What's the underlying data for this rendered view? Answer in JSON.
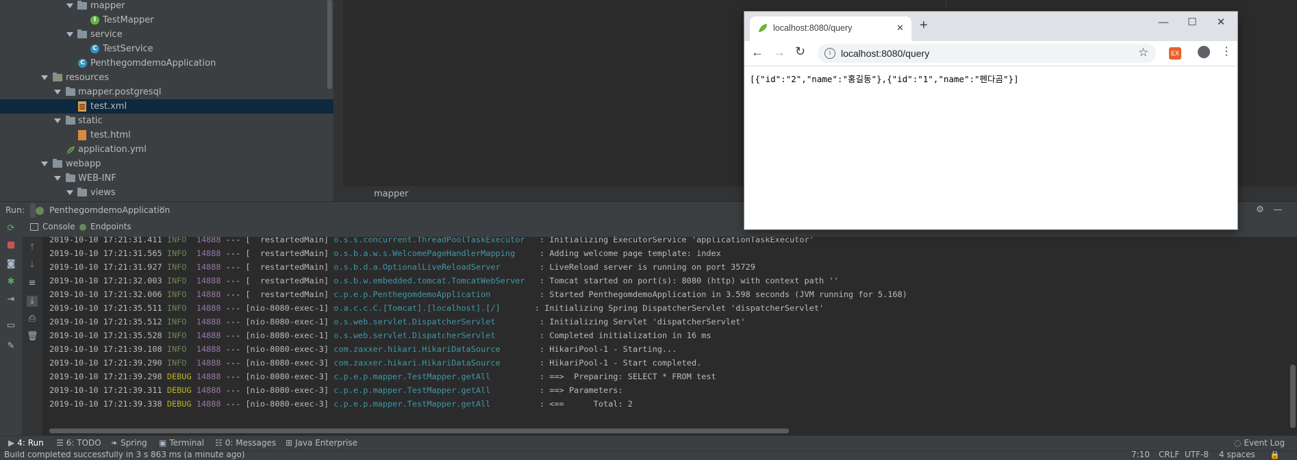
{
  "project_tree": {
    "items": [
      {
        "label": "mapper",
        "kind": "folder"
      },
      {
        "label": "TestMapper",
        "kind": "mapper-file"
      },
      {
        "label": "service",
        "kind": "folder"
      },
      {
        "label": "TestService",
        "kind": "class-file"
      },
      {
        "label": "PenthegomdemoApplication",
        "kind": "springboot-file"
      },
      {
        "label": "resources",
        "kind": "resources-folder"
      },
      {
        "label": "mapper.postgresql",
        "kind": "folder"
      },
      {
        "label": "test.xml",
        "kind": "xml-file",
        "selected": true
      },
      {
        "label": "static",
        "kind": "folder"
      },
      {
        "label": "test.html",
        "kind": "html-file"
      },
      {
        "label": "application.yml",
        "kind": "yml-file"
      },
      {
        "label": "webapp",
        "kind": "folder"
      },
      {
        "label": "WEB-INF",
        "kind": "folder"
      },
      {
        "label": "views",
        "kind": "folder"
      }
    ]
  },
  "editor": {
    "breadcrumb": "mapper"
  },
  "run_panel": {
    "run_label": "Run:",
    "config_tab": "PenthegomdemoApplication",
    "subtabs": [
      "Console",
      "Endpoints"
    ]
  },
  "console": {
    "lines": [
      {
        "ts": "2019-10-10 17:21:31.411",
        "level": "INFO ",
        "pid": "14888",
        "sep": " --- [",
        "thread": "  restartedMain]",
        "logger": " o.s.s.concurrent.ThreadPoolTaskExecutor  ",
        "msg": " : Initializing ExecutorService 'applicationTaskExecutor'"
      },
      {
        "ts": "2019-10-10 17:21:31.565",
        "level": "INFO ",
        "pid": "14888",
        "sep": " --- [",
        "thread": "  restartedMain]",
        "logger": " o.s.b.a.w.s.WelcomePageHandlerMapping    ",
        "msg": " : Adding welcome page template: index"
      },
      {
        "ts": "2019-10-10 17:21:31.927",
        "level": "INFO ",
        "pid": "14888",
        "sep": " --- [",
        "thread": "  restartedMain]",
        "logger": " o.s.b.d.a.OptionalLiveReloadServer       ",
        "msg": " : LiveReload server is running on port 35729"
      },
      {
        "ts": "2019-10-10 17:21:32.003",
        "level": "INFO ",
        "pid": "14888",
        "sep": " --- [",
        "thread": "  restartedMain]",
        "logger": " o.s.b.w.embedded.tomcat.TomcatWebServer  ",
        "msg": " : Tomcat started on port(s): 8080 (http) with context path ''"
      },
      {
        "ts": "2019-10-10 17:21:32.006",
        "level": "INFO ",
        "pid": "14888",
        "sep": " --- [",
        "thread": "  restartedMain]",
        "logger": " c.p.e.p.PenthegomdemoApplication         ",
        "msg": " : Started PenthegomdemoApplication in 3.598 seconds (JVM running for 5.168)"
      },
      {
        "ts": "2019-10-10 17:21:35.511",
        "level": "INFO ",
        "pid": "14888",
        "sep": " --- [",
        "thread": "nio-8080-exec-1]",
        "logger": " o.a.c.c.C.[Tomcat].[localhost].[/]      ",
        "msg": " : Initializing Spring DispatcherServlet 'dispatcherServlet'"
      },
      {
        "ts": "2019-10-10 17:21:35.512",
        "level": "INFO ",
        "pid": "14888",
        "sep": " --- [",
        "thread": "nio-8080-exec-1]",
        "logger": " o.s.web.servlet.DispatcherServlet        ",
        "msg": " : Initializing Servlet 'dispatcherServlet'"
      },
      {
        "ts": "2019-10-10 17:21:35.528",
        "level": "INFO ",
        "pid": "14888",
        "sep": " --- [",
        "thread": "nio-8080-exec-1]",
        "logger": " o.s.web.servlet.DispatcherServlet        ",
        "msg": " : Completed initialization in 16 ms"
      },
      {
        "ts": "2019-10-10 17:21:39.108",
        "level": "INFO ",
        "pid": "14888",
        "sep": " --- [",
        "thread": "nio-8080-exec-3]",
        "logger": " com.zaxxer.hikari.HikariDataSource       ",
        "msg": " : HikariPool-1 - Starting..."
      },
      {
        "ts": "2019-10-10 17:21:39.290",
        "level": "INFO ",
        "pid": "14888",
        "sep": " --- [",
        "thread": "nio-8080-exec-3]",
        "logger": " com.zaxxer.hikari.HikariDataSource       ",
        "msg": " : HikariPool-1 - Start completed."
      },
      {
        "ts": "2019-10-10 17:21:39.298",
        "level": "DEBUG",
        "pid": "14888",
        "sep": " --- [",
        "thread": "nio-8080-exec-3]",
        "logger": " c.p.e.p.mapper.TestMapper.getAll         ",
        "msg": " : ==>  Preparing: SELECT * FROM test"
      },
      {
        "ts": "2019-10-10 17:21:39.311",
        "level": "DEBUG",
        "pid": "14888",
        "sep": " --- [",
        "thread": "nio-8080-exec-3]",
        "logger": " c.p.e.p.mapper.TestMapper.getAll         ",
        "msg": " : ==> Parameters: "
      },
      {
        "ts": "2019-10-10 17:21:39.338",
        "level": "DEBUG",
        "pid": "14888",
        "sep": " --- [",
        "thread": "nio-8080-exec-3]",
        "logger": " c.p.e.p.mapper.TestMapper.getAll         ",
        "msg": " : <==      Total: 2"
      }
    ]
  },
  "bottom_tabs": [
    {
      "label": "4: Run",
      "icon": "run-icon"
    },
    {
      "label": "6: TODO",
      "icon": "todo-icon"
    },
    {
      "label": "Spring",
      "icon": "spring-icon"
    },
    {
      "label": "Terminal",
      "icon": "terminal-icon"
    },
    {
      "label": "0: Messages",
      "icon": "messages-icon"
    },
    {
      "label": "Java Enterprise",
      "icon": "java-enterprise-icon"
    }
  ],
  "event_log": "Event Log",
  "status_bar": {
    "message": "Build completed successfully in 3 s 863 ms (a minute ago)",
    "position": "7:10",
    "line_sep": "CRLF",
    "encoding": "UTF-8",
    "indent": "4 spaces"
  },
  "browser": {
    "tab_title": "localhost:8080/query",
    "url": "localhost:8080/query",
    "body_text": "[{\"id\":\"2\",\"name\":\"홍길동\"},{\"id\":\"1\",\"name\":\"펜다곰\"}]",
    "colors": {
      "titlebar": "#dee1e6",
      "omnibox": "#f1f3f4",
      "extension": "#e8622c"
    }
  },
  "colors": {
    "ide_bg": "#2b2b2b",
    "panel_bg": "#3c3f41",
    "info": "#6a8759",
    "debug": "#bbb529",
    "logger": "#3f97a8",
    "selection": "#0d293e"
  }
}
